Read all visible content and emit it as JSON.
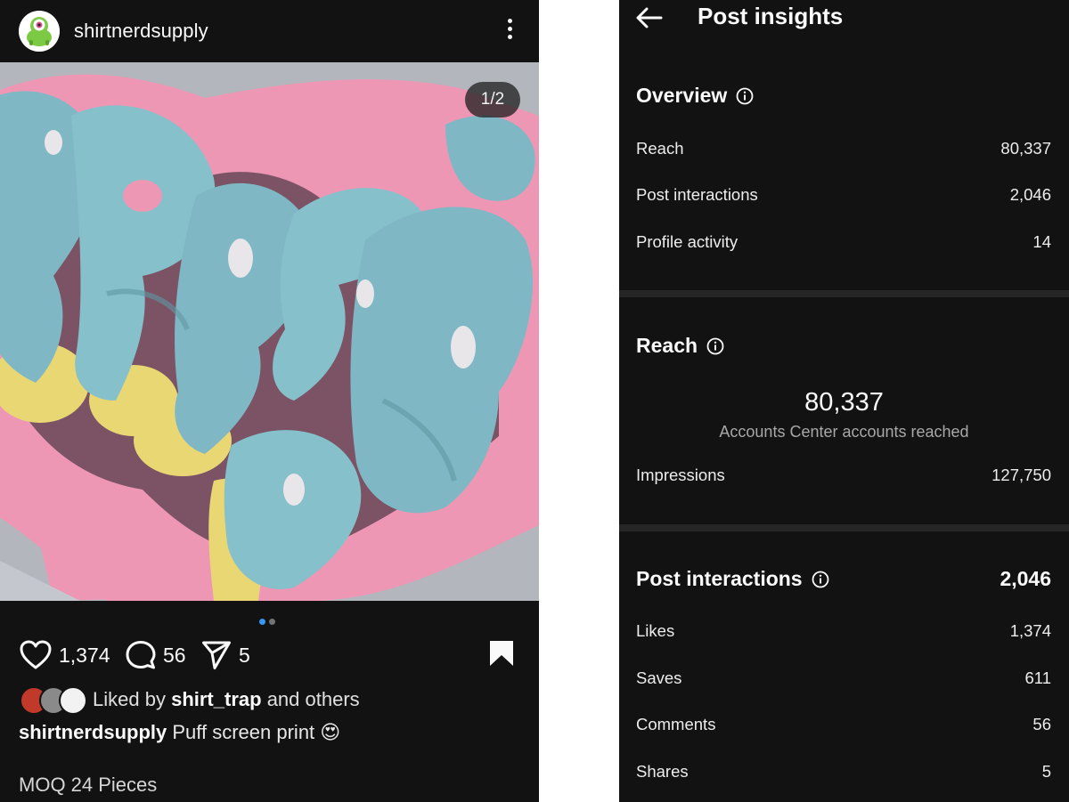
{
  "post": {
    "username": "shirtnerdsupply",
    "image_counter": "1/2",
    "likes": "1,374",
    "comments": "56",
    "shares": "5",
    "liked_by_prefix": "Liked by",
    "liked_by_user": "shirt_trap",
    "liked_by_suffix": "and others",
    "caption_user": "shirtnerdsupply",
    "caption_text": "Puff screen print",
    "caption_emoji": "😍",
    "caption_line2": "MOQ 24 Pieces",
    "carousel": {
      "total": 2,
      "active": 1
    }
  },
  "insights": {
    "title": "Post insights",
    "overview": {
      "title": "Overview",
      "rows": [
        {
          "label": "Reach",
          "value": "80,337"
        },
        {
          "label": "Post interactions",
          "value": "2,046"
        },
        {
          "label": "Profile activity",
          "value": "14"
        }
      ]
    },
    "reach": {
      "title": "Reach",
      "big_value": "80,337",
      "big_caption": "Accounts Center accounts reached",
      "rows": [
        {
          "label": "Impressions",
          "value": "127,750"
        }
      ]
    },
    "interactions": {
      "title": "Post interactions",
      "total": "2,046",
      "rows": [
        {
          "label": "Likes",
          "value": "1,374"
        },
        {
          "label": "Saves",
          "value": "611"
        },
        {
          "label": "Comments",
          "value": "56"
        },
        {
          "label": "Shares",
          "value": "5"
        }
      ]
    }
  },
  "colors": {
    "background": "#121212",
    "divider": "#262626",
    "text": "#fafafa",
    "muted": "#a8a8a8",
    "carousel_active": "#3897f0",
    "carousel_inactive": "#737373"
  },
  "icons": [
    "avatar-icon",
    "more-icon",
    "heart-icon",
    "comment-icon",
    "send-icon",
    "bookmark-icon",
    "back-arrow-icon",
    "info-icon"
  ]
}
